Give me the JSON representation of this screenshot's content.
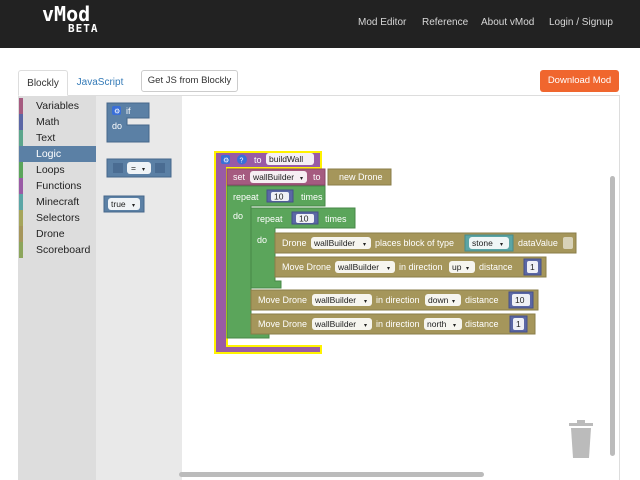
{
  "header": {
    "logo": "vMod",
    "logo_sub": "BETA",
    "nav": [
      {
        "label": "Mod Editor"
      },
      {
        "label": "Reference"
      },
      {
        "label": "About vMod"
      },
      {
        "label": "Login / Signup"
      }
    ]
  },
  "tabs": [
    {
      "label": "Blockly",
      "active": true
    },
    {
      "label": "JavaScript",
      "active": false
    }
  ],
  "toolbar": {
    "get_js_label": "Get JS from Blockly",
    "download_label": "Download Mod"
  },
  "toolbox": {
    "categories": [
      {
        "label": "Variables",
        "color": "#a55b80"
      },
      {
        "label": "Math",
        "color": "#5b67a5"
      },
      {
        "label": "Text",
        "color": "#5ba58c"
      },
      {
        "label": "Logic",
        "color": "#5b80a5",
        "selected": true
      },
      {
        "label": "Loops",
        "color": "#5ba55b"
      },
      {
        "label": "Functions",
        "color": "#995ba5"
      },
      {
        "label": "Minecraft",
        "color": "#5ba5a5"
      },
      {
        "label": "Selectors",
        "color": "#a5a55b"
      },
      {
        "label": "Drone",
        "color": "#a5965b"
      },
      {
        "label": "Scoreboard",
        "color": "#8ca55b"
      }
    ]
  },
  "flyout": {
    "if_label": "if",
    "do_label": "do",
    "compare_op": "=",
    "bool_value": "true"
  },
  "program": {
    "proc_to": "to",
    "proc_name": "buildWall",
    "set_label": "set",
    "var_name": "wallBuilder",
    "to_label": "to",
    "new_drone": "new Drone",
    "repeat_label": "repeat",
    "times_label": "times",
    "do_label": "do",
    "outer_repeat": "10",
    "inner_repeat": "10",
    "drone_label": "Drone",
    "places_block": "places block of type",
    "block_type": "stone",
    "data_value": "dataValue",
    "move_drone": "Move Drone",
    "in_direction": "in direction",
    "distance": "distance",
    "moves": [
      {
        "direction": "up",
        "distance": "1"
      },
      {
        "direction": "down",
        "distance": "10"
      },
      {
        "direction": "north",
        "distance": "1"
      }
    ]
  },
  "colors": {
    "procedure": "#995ba5",
    "variable": "#a55b80",
    "loop": "#5ba55b",
    "drone": "#a5965b",
    "math": "#5b67a5",
    "logic": "#5b80a5",
    "minecraft": "#5ba5a5",
    "highlight": "#fff200"
  },
  "icons": {
    "gear": "gear-icon",
    "help": "help-icon",
    "trash": "trash-icon"
  }
}
